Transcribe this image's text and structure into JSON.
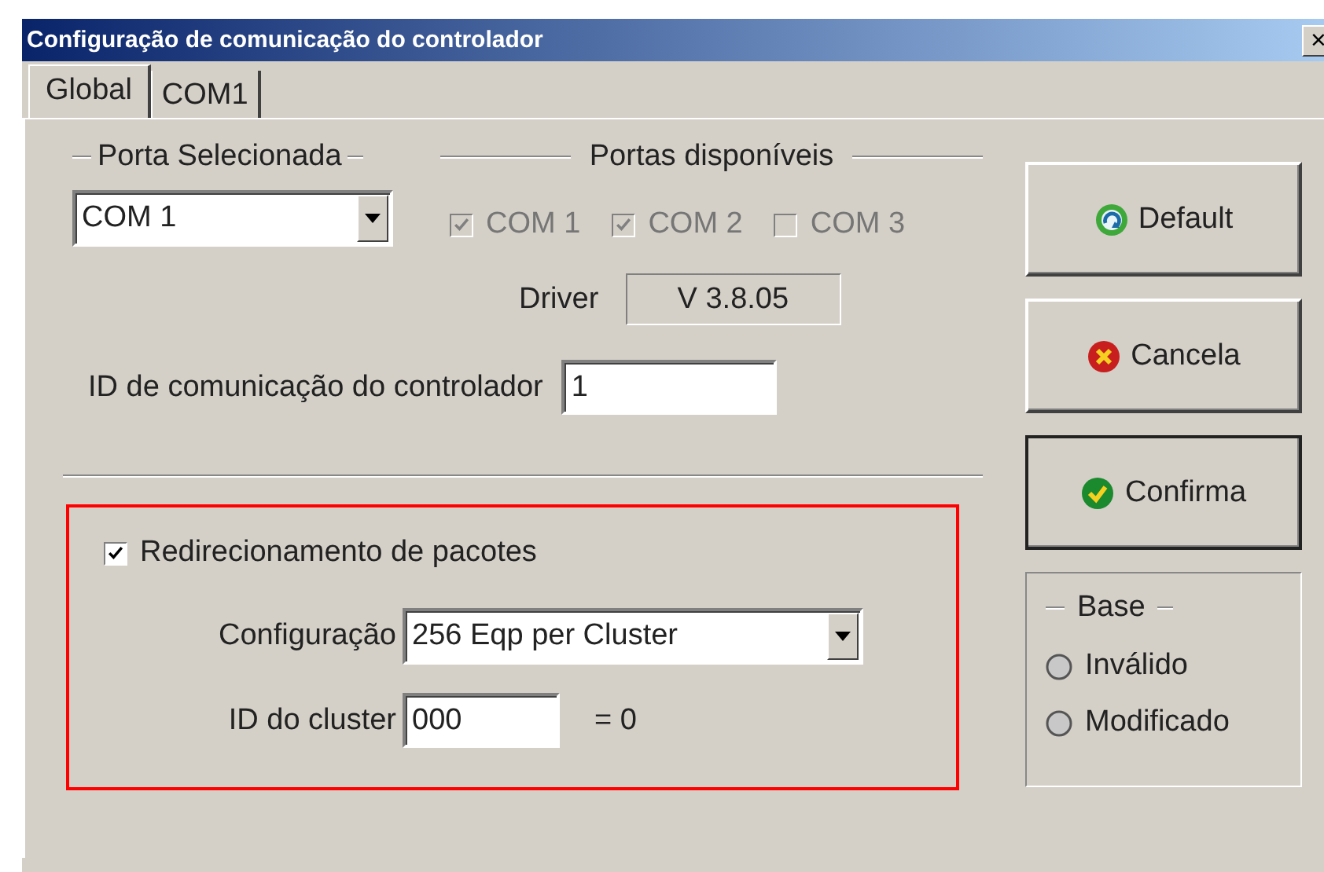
{
  "window": {
    "title": "Configuração de comunicação do controlador",
    "close": "×"
  },
  "tabs": [
    {
      "label": "Global",
      "selected": true
    },
    {
      "label": "COM1",
      "selected": false
    }
  ],
  "selected_port": {
    "label": "Porta Selecionada",
    "value": "COM 1"
  },
  "available_ports": {
    "label": "Portas disponíveis",
    "ports": [
      {
        "label": "COM 1",
        "checked": true,
        "disabled": true
      },
      {
        "label": "COM 2",
        "checked": true,
        "disabled": true
      },
      {
        "label": "COM 3",
        "checked": false,
        "disabled": true
      }
    ]
  },
  "driver": {
    "label": "Driver",
    "value": "V 3.8.05"
  },
  "controller_id": {
    "label": "ID de comunicação do controlador",
    "value": "1"
  },
  "packet_redirect": {
    "label": "Redirecionamento de pacotes",
    "checked": true,
    "configuration": {
      "label": "Configuração",
      "value": "256 Eqp per Cluster"
    },
    "cluster_id": {
      "label": "ID do cluster",
      "value": "000",
      "result": "= 0"
    }
  },
  "buttons": [
    {
      "label": "Default",
      "kind": "refresh",
      "is_default": false
    },
    {
      "label": "Cancela",
      "kind": "cancel",
      "is_default": false
    },
    {
      "label": "Confirma",
      "kind": "confirm",
      "is_default": true
    }
  ],
  "base": {
    "label": "Base",
    "options": [
      {
        "label": "Inválido",
        "selected": false
      },
      {
        "label": "Modificado",
        "selected": false
      }
    ]
  }
}
